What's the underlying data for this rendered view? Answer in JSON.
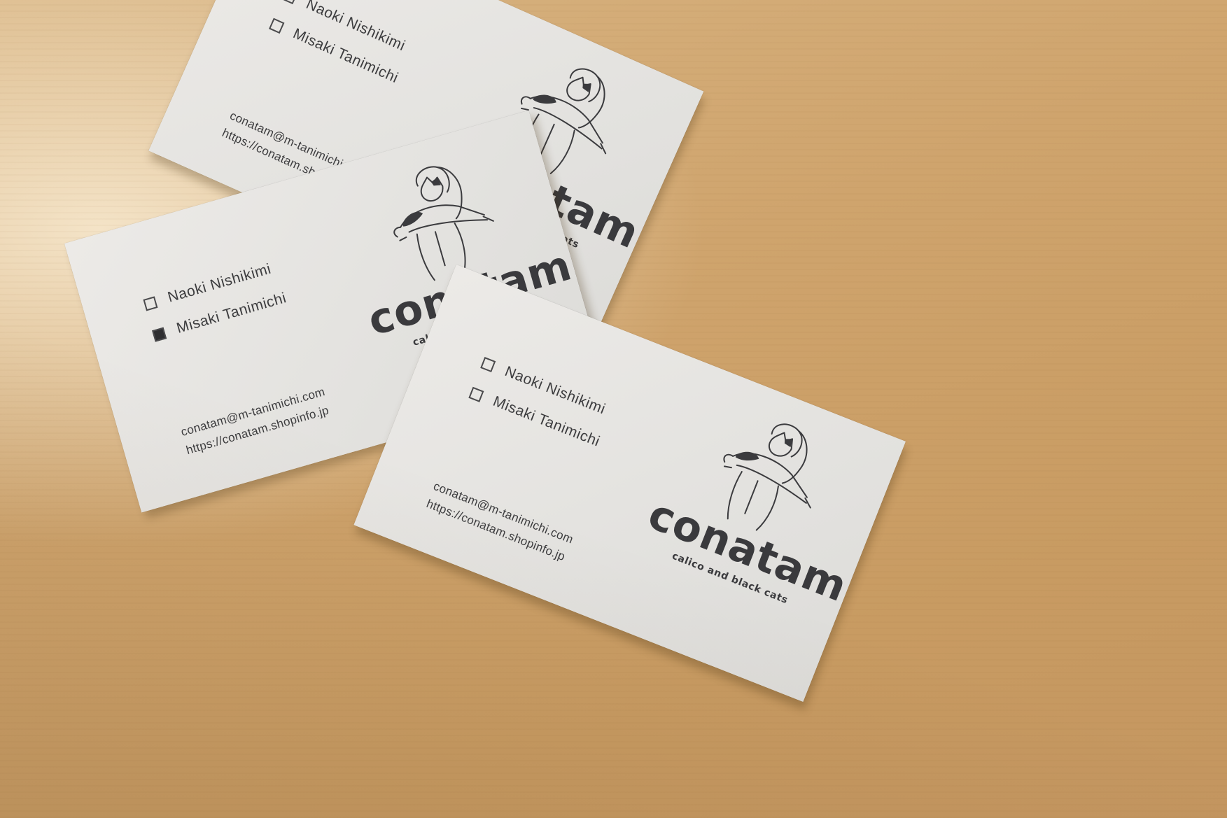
{
  "cards": [
    {
      "id": "back",
      "names": [
        {
          "label": "Naoki Nishikimi",
          "checked": false
        },
        {
          "label": "Misaki Tanimichi",
          "checked": false
        }
      ],
      "email": "conatam@m-tanimichi.com",
      "url": "https://conatam.shopinfo.jp",
      "brand": "conatam",
      "tagline": "calico and black cats"
    },
    {
      "id": "middle",
      "names": [
        {
          "label": "Naoki Nishikimi",
          "checked": false
        },
        {
          "label": "Misaki Tanimichi",
          "checked": true
        }
      ],
      "email": "conatam@m-tanimichi.com",
      "url": "https://conatam.shopinfo.jp",
      "brand": "conatam",
      "tagline": "calico and black cats"
    },
    {
      "id": "front",
      "names": [
        {
          "label": "Naoki Nishikimi",
          "checked": false
        },
        {
          "label": "Misaki Tanimichi",
          "checked": false
        }
      ],
      "email": "conatam@m-tanimichi.com",
      "url": "https://conatam.shopinfo.jp",
      "brand": "conatam",
      "tagline": "calico and black cats"
    }
  ],
  "colors": {
    "surface": "#cfa46d",
    "card": "#e6e5e2",
    "ink": "#3b3b3e"
  },
  "icons": [
    "checkbox-icon",
    "girl-hugging-calico-cat-illustration"
  ]
}
